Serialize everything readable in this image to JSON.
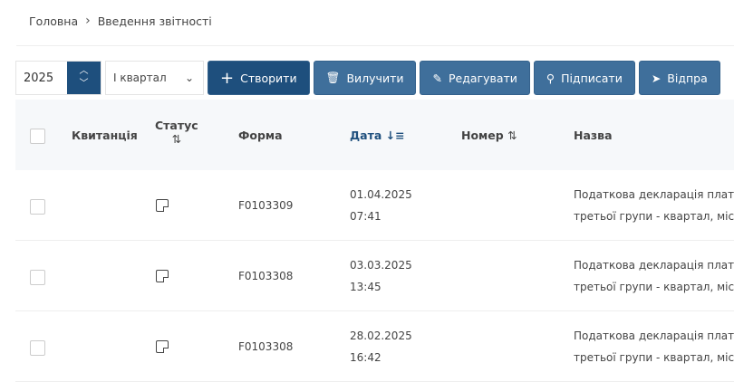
{
  "breadcrumb": {
    "home": "Головна",
    "current": "Введення звітності"
  },
  "toolbar": {
    "year": "2025",
    "quarter": "І квартал",
    "create": "Створити",
    "delete": "Вилучити",
    "edit": "Редагувати",
    "sign": "Підписати",
    "send": "Відпра"
  },
  "columns": {
    "receipt": "Квитанція",
    "status": "Статус",
    "form": "Форма",
    "date": "Дата",
    "number": "Номер",
    "name": "Назва"
  },
  "accent": "#1e4f7d",
  "rows": [
    {
      "form": "F0103309",
      "date": "01.04.2025",
      "time": "07:41",
      "name1": "Податкова декларація плат",
      "name2": "третьої групи - квартал, міс"
    },
    {
      "form": "F0103308",
      "date": "03.03.2025",
      "time": "13:45",
      "name1": "Податкова декларація плат",
      "name2": "третьої групи - квартал, міс"
    },
    {
      "form": "F0103308",
      "date": "28.02.2025",
      "time": "16:42",
      "name1": "Податкова декларація плат",
      "name2": "третьої групи - квартал, міс"
    }
  ]
}
